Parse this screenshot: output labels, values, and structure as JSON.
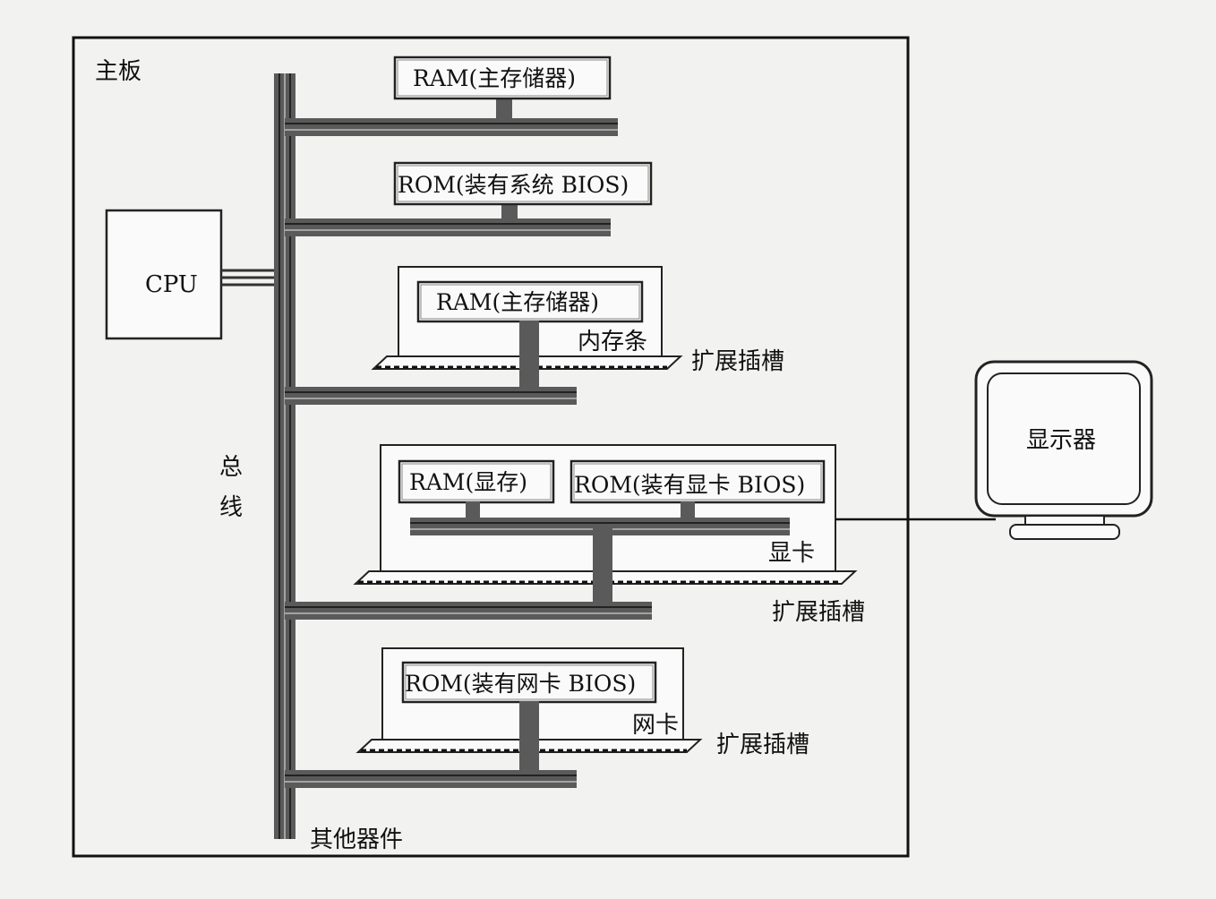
{
  "board": {
    "label": "主板"
  },
  "cpu": {
    "label": "CPU"
  },
  "bus": {
    "label_1": "总",
    "label_2": "线"
  },
  "ram_main": {
    "label": "RAM(主存储器)"
  },
  "rom_bios": {
    "label": "ROM(装有系统 BIOS)"
  },
  "memory_module": {
    "chip_label": "RAM(主存储器)",
    "card_label": "内存条",
    "slot_label": "扩展插槽"
  },
  "graphics_card": {
    "ram_label": "RAM(显存)",
    "rom_label": "ROM(装有显卡 BIOS)",
    "card_label": "显卡",
    "slot_label": "扩展插槽"
  },
  "network_card": {
    "rom_label": "ROM(装有网卡 BIOS)",
    "card_label": "网卡",
    "slot_label": "扩展插槽"
  },
  "other_devices": {
    "label": "其他器件"
  },
  "monitor": {
    "label": "显示器"
  }
}
